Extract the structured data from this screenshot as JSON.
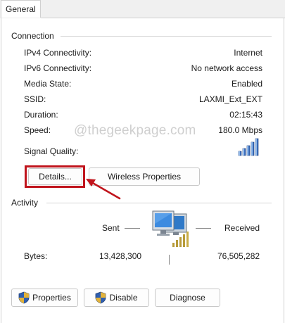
{
  "tab": {
    "label": "General"
  },
  "connection": {
    "title": "Connection",
    "rows": [
      {
        "label": "IPv4 Connectivity:",
        "value": "Internet"
      },
      {
        "label": "IPv6 Connectivity:",
        "value": "No network access"
      },
      {
        "label": "Media State:",
        "value": "Enabled"
      },
      {
        "label": "SSID:",
        "value": "LAXMI_Ext_EXT"
      },
      {
        "label": "Duration:",
        "value": "02:15:43"
      },
      {
        "label": "Speed:",
        "value": "180.0 Mbps"
      }
    ],
    "signal_quality_label": "Signal Quality:",
    "signal_icon": "signal-bars-icon"
  },
  "watermark": "@thegeekpage.com",
  "buttons": {
    "details": "Details...",
    "wireless_properties": "Wireless Properties"
  },
  "activity": {
    "title": "Activity",
    "sent_label": "Sent",
    "received_label": "Received",
    "bytes_label": "Bytes:",
    "bytes_sent": "13,428,300",
    "bytes_received": "76,505,282",
    "icon": "network-computers-icon"
  },
  "footer_buttons": {
    "properties": "Properties",
    "disable": "Disable",
    "diagnose": "Diagnose"
  },
  "colors": {
    "highlight": "#c0141c",
    "shield_blue": "#2f5fb0",
    "shield_gold": "#e2b23a"
  }
}
